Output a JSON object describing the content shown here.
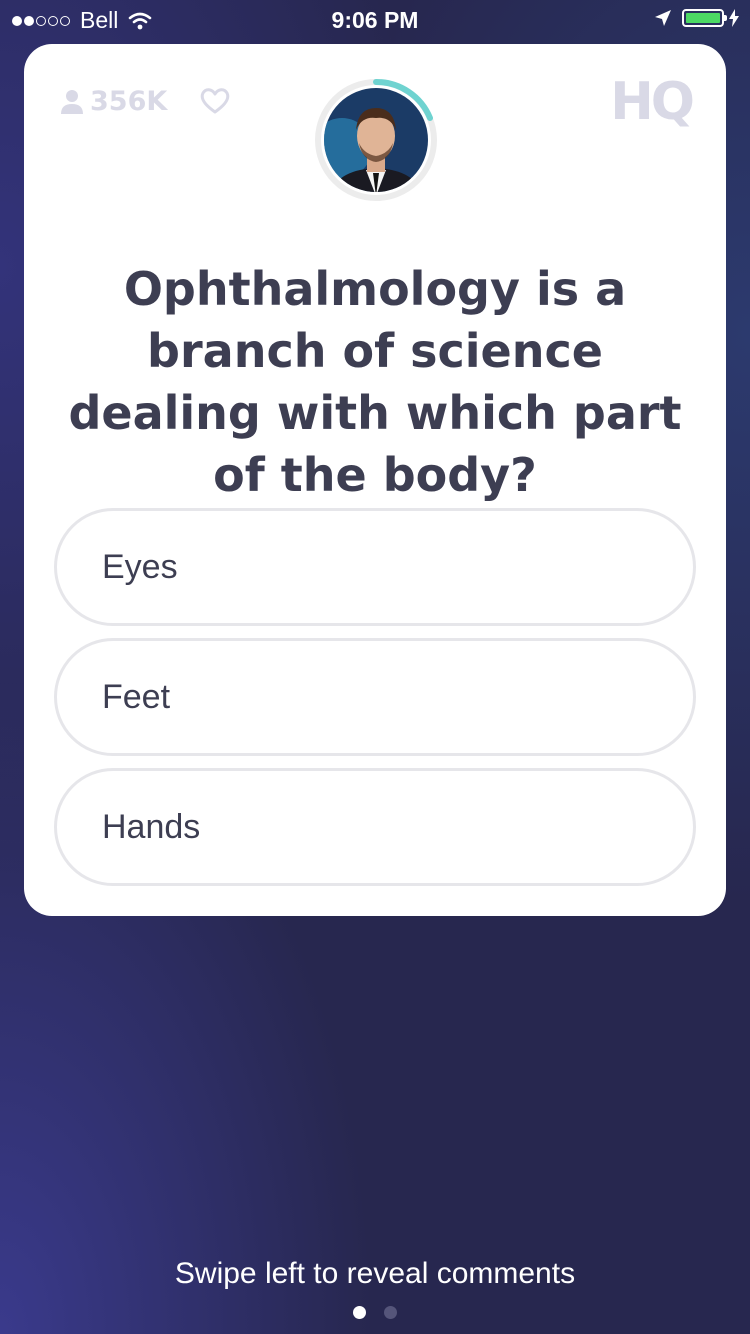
{
  "status_bar": {
    "carrier": "Bell",
    "time": "9:06 PM",
    "signal_bars_filled": 2,
    "signal_bars_total": 5,
    "battery_color": "#4cd964"
  },
  "header": {
    "viewer_count": "356K",
    "logo_text": "HQ",
    "icons": [
      "user-icon",
      "heart-icon"
    ]
  },
  "question": {
    "text": "Ophthalmology is a branch of science dealing with which part of the body?"
  },
  "answers": [
    {
      "label": "Eyes"
    },
    {
      "label": "Feet"
    },
    {
      "label": "Hands"
    }
  ],
  "footer": {
    "swipe_hint": "Swipe left to reveal comments",
    "page_count": 2,
    "active_page": 1
  }
}
